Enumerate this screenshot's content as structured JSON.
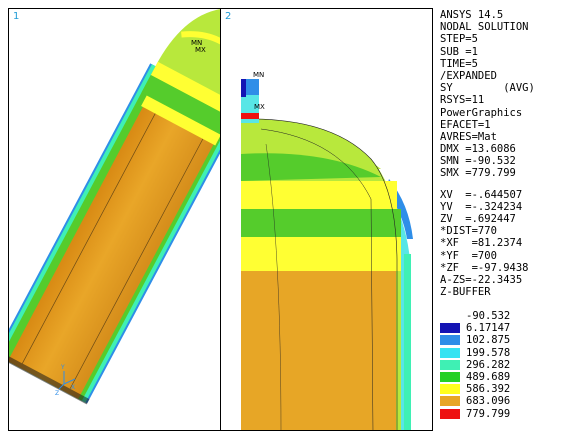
{
  "viewports": [
    {
      "number": "1",
      "min_label": "MN",
      "max_label": "MX",
      "triad": {
        "y": "Y",
        "z": "Z",
        "x": "X"
      }
    },
    {
      "number": "2",
      "min_label": "MN",
      "max_label": "MX"
    }
  ],
  "info_lines": [
    "ANSYS 14.5",
    "NODAL SOLUTION",
    "STEP=5",
    "SUB =1",
    "TIME=5",
    "/EXPANDED",
    "SY        (AVG)",
    "RSYS=11",
    "PowerGraphics",
    "EFACET=1",
    "AVRES=Mat",
    "DMX =13.6086",
    "SMN =-90.532",
    "SMX =779.799"
  ],
  "view_lines": [
    "XV  =-.644507",
    "YV  =-.324234",
    "ZV  =.692447",
    "*DIST=770",
    "*XF  =81.2374",
    "*YF  =700",
    "*ZF  =-97.9438",
    "A-ZS=-22.3435",
    "Z-BUFFER"
  ],
  "legend": {
    "top_value": "-90.532",
    "bands": [
      {
        "color": "#1414b4",
        "label": "6.17147"
      },
      {
        "color": "#2f8ee8",
        "label": "102.875"
      },
      {
        "color": "#37e3f2",
        "label": "199.578"
      },
      {
        "color": "#3ff0b4",
        "label": "296.282"
      },
      {
        "color": "#25d025",
        "label": "489.689"
      },
      {
        "color": "#ffff1e",
        "label": "586.392"
      },
      {
        "color": "#e7a626",
        "label": "683.096"
      },
      {
        "color": "#ee1111",
        "label": "779.799"
      }
    ]
  },
  "colors": {
    "body_orange": "#e7a626",
    "green": "#55cc2c",
    "light_green": "#b8e83c",
    "yellow": "#ffff33",
    "cyan": "#58e6e6",
    "teal": "#3ff0b4",
    "blue": "#2f8ee8",
    "dark_blue": "#1414b4",
    "red": "#ee1111"
  }
}
